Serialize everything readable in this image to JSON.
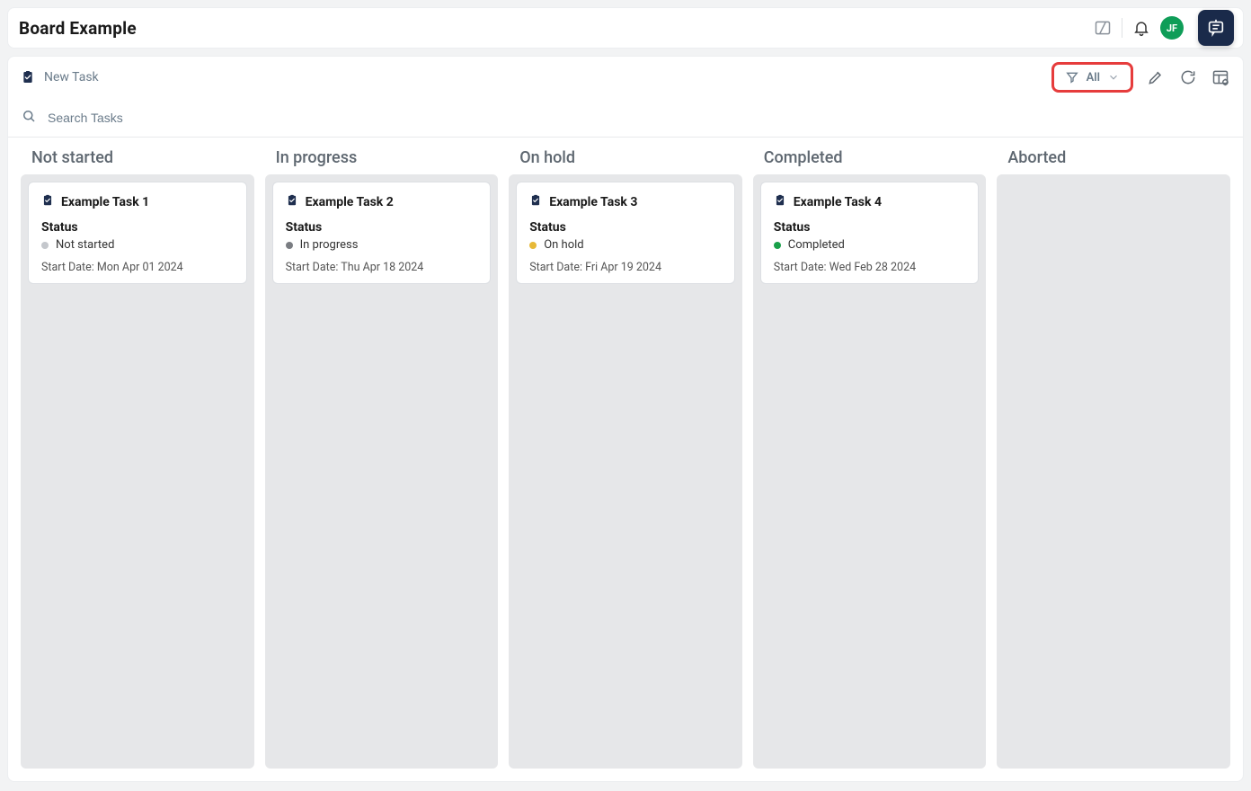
{
  "header": {
    "title": "Board Example",
    "avatar_initials": "JF"
  },
  "toolbar": {
    "new_task_label": "New Task",
    "filter_label": "All"
  },
  "search": {
    "placeholder": "Search Tasks"
  },
  "status_field_label": "Status",
  "start_date_prefix": "Start Date: ",
  "status_colors": {
    "Not started": "#c4c7cc",
    "In progress": "#7a7d82",
    "On hold": "#e7b938",
    "Completed": "#1aa04a",
    "Aborted": "#c0392b"
  },
  "columns": [
    {
      "title": "Not started",
      "tasks": [
        {
          "title": "Example Task 1",
          "status": "Not started",
          "start_date": "Mon Apr 01 2024"
        }
      ]
    },
    {
      "title": "In progress",
      "tasks": [
        {
          "title": "Example Task 2",
          "status": "In progress",
          "start_date": "Thu Apr 18 2024"
        }
      ]
    },
    {
      "title": "On hold",
      "tasks": [
        {
          "title": "Example Task 3",
          "status": "On hold",
          "start_date": "Fri Apr 19 2024"
        }
      ]
    },
    {
      "title": "Completed",
      "tasks": [
        {
          "title": "Example Task 4",
          "status": "Completed",
          "start_date": "Wed Feb 28 2024"
        }
      ]
    },
    {
      "title": "Aborted",
      "tasks": []
    }
  ]
}
